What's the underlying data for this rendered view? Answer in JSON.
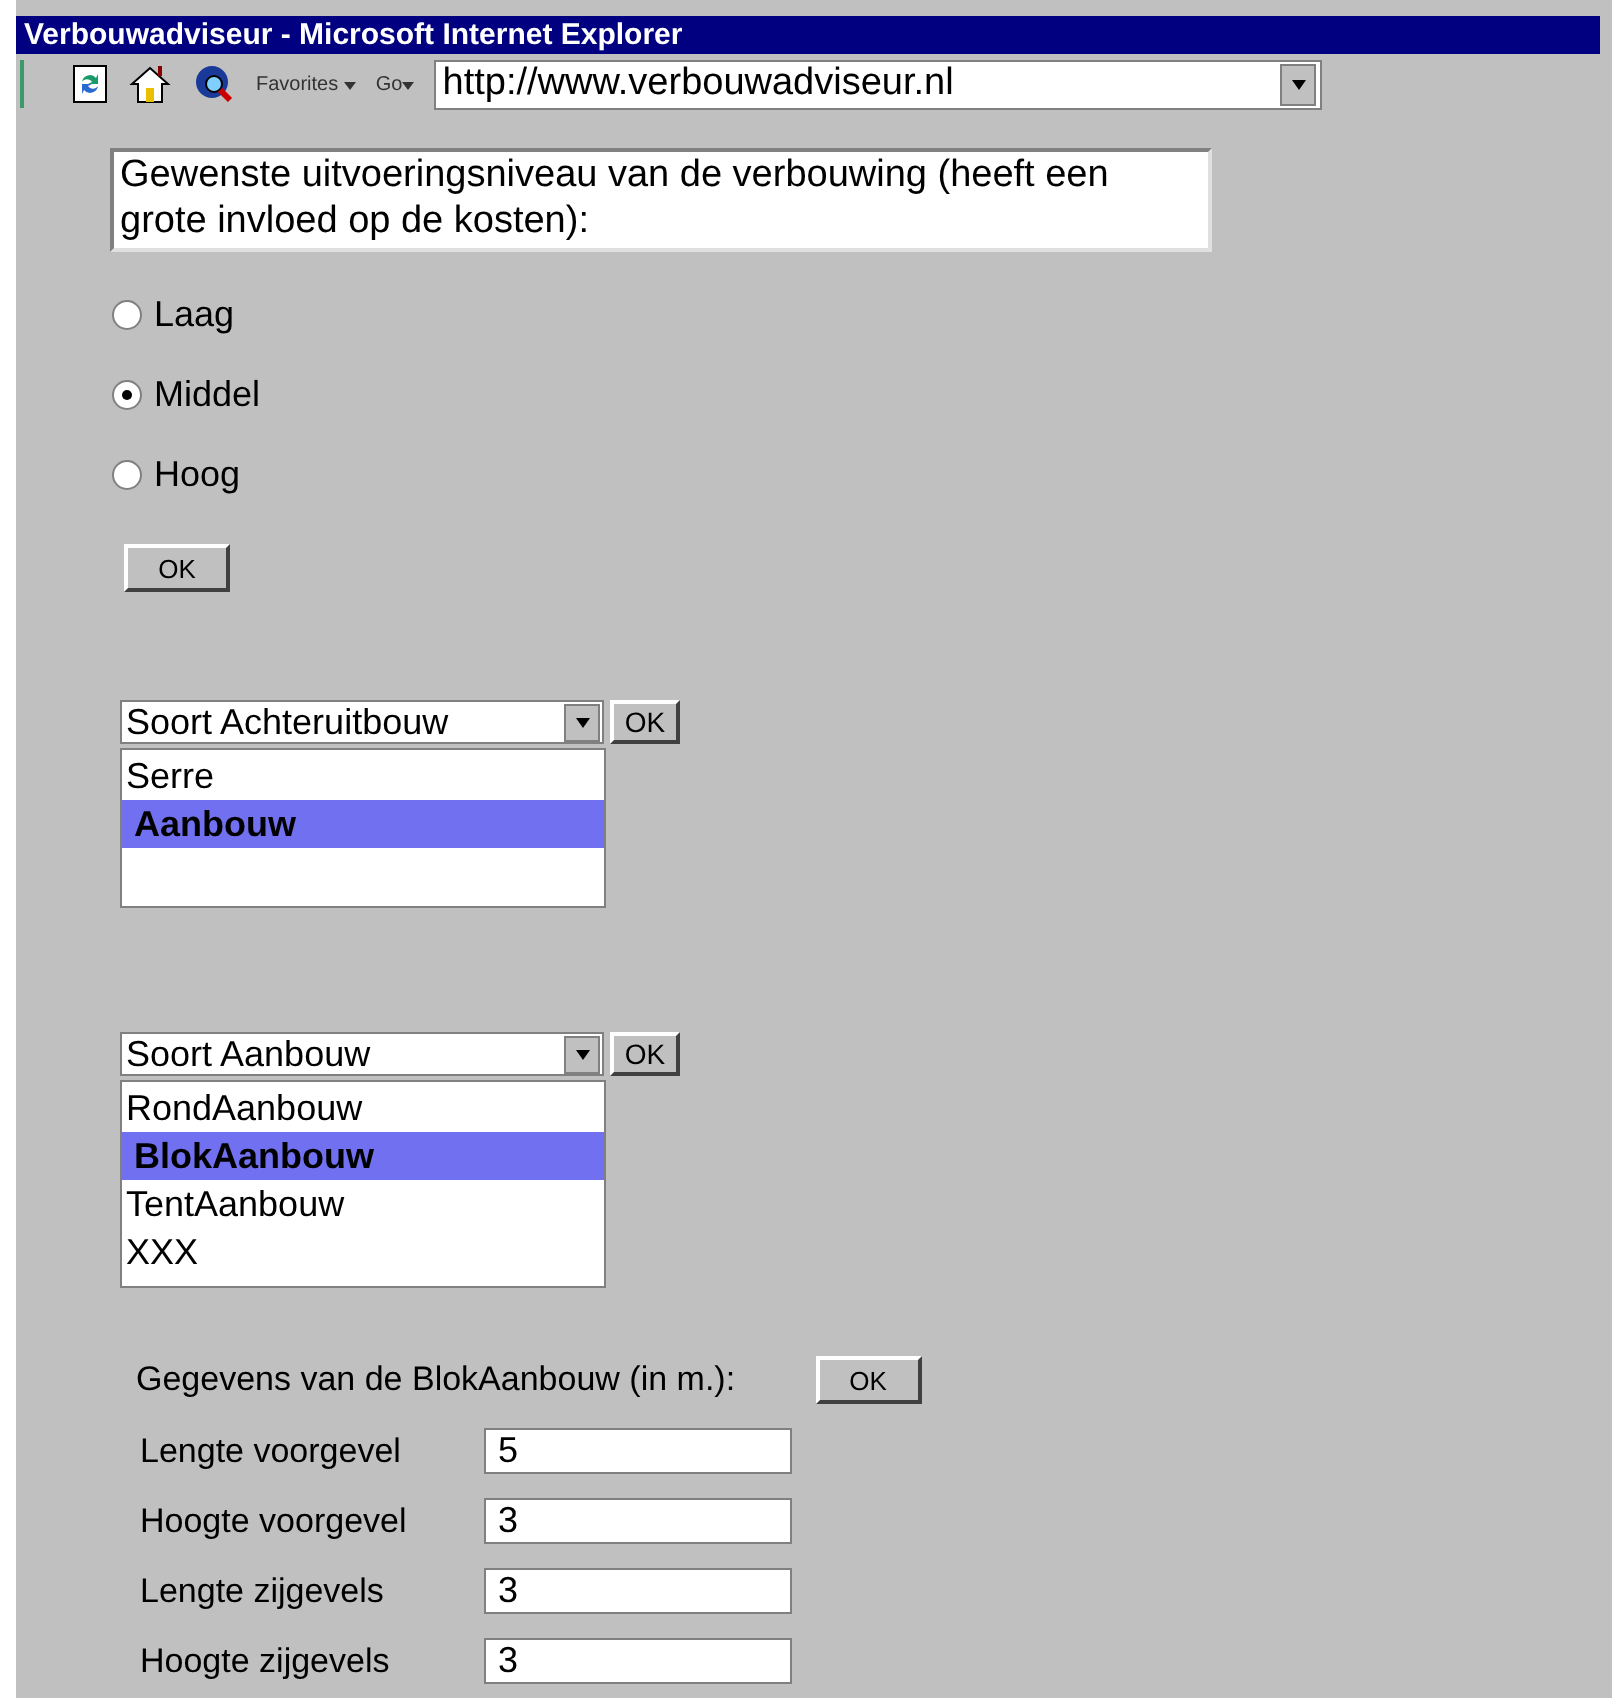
{
  "window": {
    "title": "Verbouwadviseur - Microsoft Internet Explorer"
  },
  "toolbar": {
    "favorites": "Favorites",
    "go": "Go",
    "address": "http://www.verbouwadviseur.nl"
  },
  "question": "Gewenste uitvoeringsniveau van de verbouwing (heeft een grote invloed op de kosten):",
  "levels": [
    {
      "label": "Laag",
      "selected": false
    },
    {
      "label": "Middel",
      "selected": true
    },
    {
      "label": "Hoog",
      "selected": false
    }
  ],
  "level_ok": "OK",
  "selects": [
    {
      "value": "Soort Achteruitbouw",
      "ok": "OK",
      "options": [
        {
          "label": "Serre",
          "selected": false
        },
        {
          "label": "Aanbouw",
          "selected": true
        }
      ]
    },
    {
      "value": "Soort Aanbouw",
      "ok": "OK",
      "options": [
        {
          "label": "RondAanbouw",
          "selected": false
        },
        {
          "label": "BlokAanbouw",
          "selected": true
        },
        {
          "label": "TentAanbouw",
          "selected": false
        },
        {
          "label": "XXX",
          "selected": false
        }
      ]
    }
  ],
  "details": {
    "title": "Gegevens van de BlokAanbouw (in m.):",
    "ok": "OK",
    "fields": [
      {
        "label": "Lengte voorgevel",
        "value": "5"
      },
      {
        "label": "Hoogte voorgevel",
        "value": "3"
      },
      {
        "label": "Lengte zijgevels",
        "value": "3"
      },
      {
        "label": "Hoogte zijgevels",
        "value": "3"
      }
    ]
  }
}
